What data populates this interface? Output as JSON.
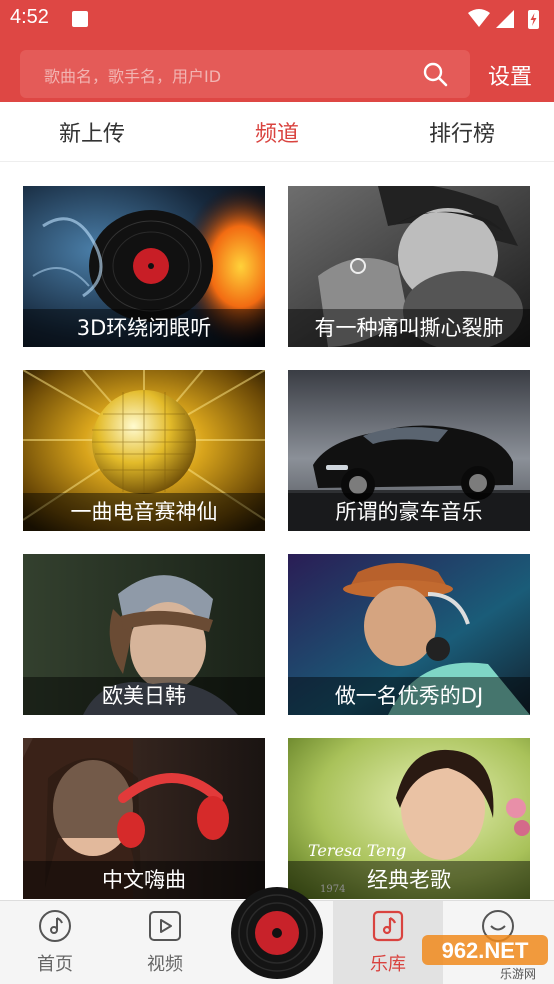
{
  "status": {
    "time": "4:52"
  },
  "search": {
    "placeholder": "歌曲名，歌手名，用户ID"
  },
  "header": {
    "settings_label": "设置"
  },
  "tabs": [
    {
      "label": "新上传",
      "active": false
    },
    {
      "label": "频道",
      "active": true
    },
    {
      "label": "排行榜",
      "active": false
    }
  ],
  "channels": [
    {
      "title": "3D环绕闭眼听"
    },
    {
      "title": "有一种痛叫撕心裂肺"
    },
    {
      "title": "一曲电音赛神仙"
    },
    {
      "title": "所谓的豪车音乐"
    },
    {
      "title": "欧美日韩"
    },
    {
      "title": "做一名优秀的DJ"
    },
    {
      "title": "中文嗨曲"
    },
    {
      "title": "经典老歌"
    }
  ],
  "card_art_text": {
    "teresa_teng": "Teresa Teng",
    "year": "1974"
  },
  "bottom_nav": [
    {
      "label": "首页",
      "icon": "music-note-circle-icon"
    },
    {
      "label": "视频",
      "icon": "play-video-icon"
    },
    {
      "label": "乐库",
      "icon": "music-library-icon",
      "active": true
    },
    {
      "label": "",
      "icon": "smile-profile-icon"
    }
  ],
  "watermark": {
    "text": "962.NET",
    "sub": "乐游网"
  },
  "colors": {
    "header": "#de4744",
    "accent": "#d9433f",
    "nav_bg": "#f5f5f5"
  }
}
